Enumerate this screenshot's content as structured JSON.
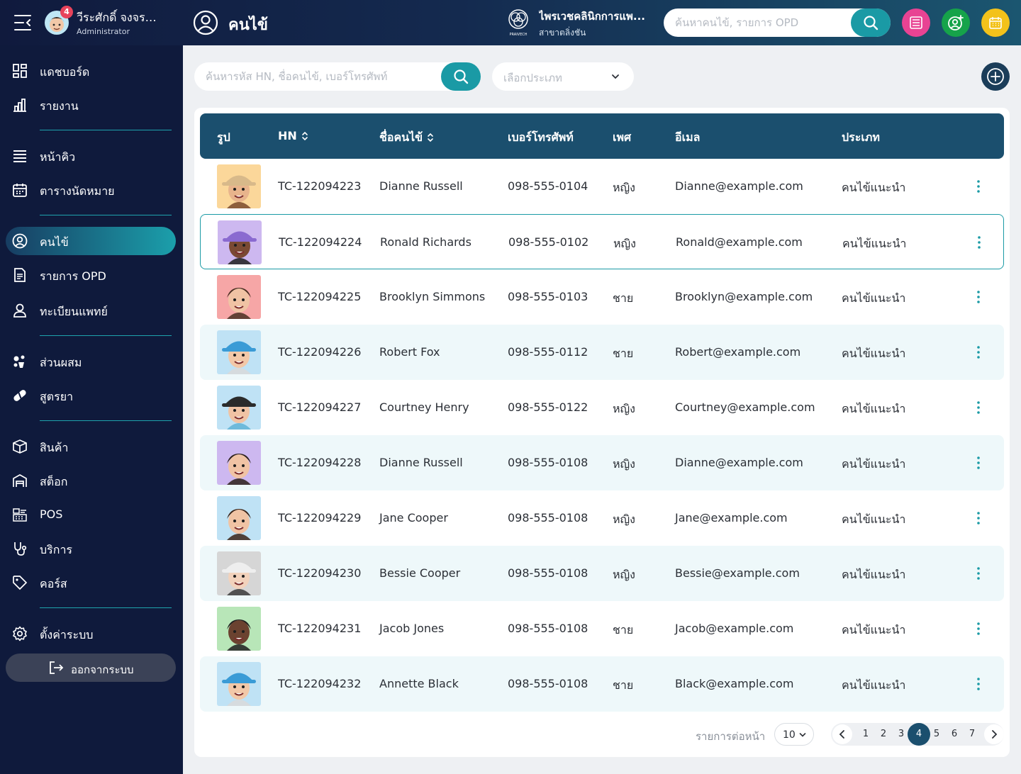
{
  "header": {
    "user_name": "วีระศักดิ์ จงจรร...",
    "user_role": "Administrator",
    "notification_count": "4",
    "page_title": "คนไข้",
    "clinic_name": "ไพรเวชคลินิกการแพ...",
    "clinic_branch": "สาขาตลิ่งชัน",
    "search_placeholder": "ค้นหาคนไข้, รายการ OPD",
    "logo_text": "PRAIVECH",
    "action_colors": {
      "list": "#e84393",
      "user_add": "#16a34a",
      "calendar": "#f3c21b"
    }
  },
  "sidebar": {
    "items": [
      {
        "label": "แดชบอร์ด",
        "icon": "dashboard-icon"
      },
      {
        "label": "รายงาน",
        "icon": "report-icon"
      },
      {
        "label": "หน้าคิว",
        "icon": "queue-icon"
      },
      {
        "label": "ตารางนัดหมาย",
        "icon": "calendar-icon"
      },
      {
        "label": "คนไข้",
        "icon": "patient-icon",
        "active": true
      },
      {
        "label": "รายการ OPD",
        "icon": "opd-list-icon"
      },
      {
        "label": "ทะเบียนแพทย์",
        "icon": "doctor-icon"
      },
      {
        "label": "ส่วนผสม",
        "icon": "ingredient-icon"
      },
      {
        "label": "สูตรยา",
        "icon": "medicine-icon"
      },
      {
        "label": "สินค้า",
        "icon": "product-icon"
      },
      {
        "label": "สต็อก",
        "icon": "stock-icon"
      },
      {
        "label": "POS",
        "icon": "pos-icon"
      },
      {
        "label": "บริการ",
        "icon": "service-icon"
      },
      {
        "label": "คอร์ส",
        "icon": "course-icon"
      },
      {
        "label": "ตั้งค่าระบบ",
        "icon": "settings-icon"
      }
    ],
    "logout_label": "ออกจากระบบ"
  },
  "toolbar": {
    "search_placeholder": "ค้นหารหัส HN, ชื่อคนไข้, เบอร์โทรศัพท์",
    "type_placeholder": "เลือกประเภท"
  },
  "table": {
    "columns": [
      "รูป",
      "HN",
      "ชื่อคนไข้",
      "เบอร์โทรศัพท์",
      "เพศ",
      "อีเมล",
      "ประเภท"
    ],
    "rows": [
      {
        "hn": "TC-122094223",
        "name": "Dianne Russell",
        "phone": "098-555-0104",
        "sex": "หญิง",
        "email": "Dianne@example.com",
        "type": "คนไข้แนะนำ",
        "avatar_bg": "#fbd79a",
        "skin": "#e8b48c",
        "hair": "#7a4a2c",
        "hat": "#d8b98a"
      },
      {
        "hn": "TC-122094224",
        "name": "Ronald Richards",
        "phone": "098-555-0102",
        "sex": "หญิง",
        "email": "Ronald@example.com",
        "type": "คนไข้แนะนำ",
        "avatar_bg": "#cdb8f0",
        "skin": "#7a4a34",
        "hair": "#1e1e1e",
        "hat": "#8a6ad0"
      },
      {
        "hn": "TC-122094225",
        "name": "Brooklyn Simmons",
        "phone": "098-555-0103",
        "sex": "ชาย",
        "email": "Brooklyn@example.com",
        "type": "คนไข้แนะนำ",
        "avatar_bg": "#f6a6a6",
        "skin": "#f0c3a4",
        "hair": "#4a2f22",
        "hat": ""
      },
      {
        "hn": "TC-122094226",
        "name": "Robert Fox",
        "phone": "098-555-0112",
        "sex": "ชาย",
        "email": "Robert@example.com",
        "type": "คนไข้แนะนำ",
        "avatar_bg": "#bfe2f5",
        "skin": "#f2c8a8",
        "hair": "#d9d9d9",
        "hat": "#3a9bd6"
      },
      {
        "hn": "TC-122094227",
        "name": "Courtney Henry",
        "phone": "098-555-0122",
        "sex": "หญิง",
        "email": "Courtney@example.com",
        "type": "คนไข้แนะนำ",
        "avatar_bg": "#bfe2f5",
        "skin": "#f0c3a4",
        "hair": "#5fb3d6",
        "hat": "#2b2b2b"
      },
      {
        "hn": "TC-122094228",
        "name": "Dianne Russell",
        "phone": "098-555-0108",
        "sex": "หญิง",
        "email": "Dianne@example.com",
        "type": "คนไข้แนะนำ",
        "avatar_bg": "#cdb8f0",
        "skin": "#f0c3a4",
        "hair": "#2b1f1a",
        "hat": ""
      },
      {
        "hn": "TC-122094229",
        "name": "Jane Cooper",
        "phone": "098-555-0108",
        "sex": "หญิง",
        "email": "Jane@example.com",
        "type": "คนไข้แนะนำ",
        "avatar_bg": "#bfe2f5",
        "skin": "#f0c3a4",
        "hair": "#3b2418",
        "hat": ""
      },
      {
        "hn": "TC-122094230",
        "name": "Bessie Cooper",
        "phone": "098-555-0108",
        "sex": "หญิง",
        "email": "Bessie@example.com",
        "type": "คนไข้แนะนำ",
        "avatar_bg": "#d6d6d6",
        "skin": "#f2d2bc",
        "hair": "#3a3a3a",
        "hat": "#eeeeee"
      },
      {
        "hn": "TC-122094231",
        "name": "Jacob Jones",
        "phone": "098-555-0108",
        "sex": "ชาย",
        "email": "Jacob@example.com",
        "type": "คนไข้แนะนำ",
        "avatar_bg": "#b8e6b8",
        "skin": "#6b4230",
        "hair": "#1e1e1e",
        "hat": ""
      },
      {
        "hn": "TC-122094232",
        "name": "Annette Black",
        "phone": "098-555-0108",
        "sex": "ชาย",
        "email": "Black@example.com",
        "type": "คนไข้แนะนำ",
        "avatar_bg": "#bfe2f5",
        "skin": "#f2c8a8",
        "hair": "#d9d9d9",
        "hat": "#3a9bd6"
      }
    ]
  },
  "pagination": {
    "per_page_label": "รายการต่อหน้า",
    "per_page_value": "10",
    "pages": [
      "1",
      "2",
      "3",
      "4",
      "5",
      "6",
      "7"
    ],
    "current_page": "4"
  },
  "colors": {
    "accent": "#1a9aa5",
    "header_row": "#1b4f6e",
    "sidebar_bg": "#0f1a3c"
  }
}
